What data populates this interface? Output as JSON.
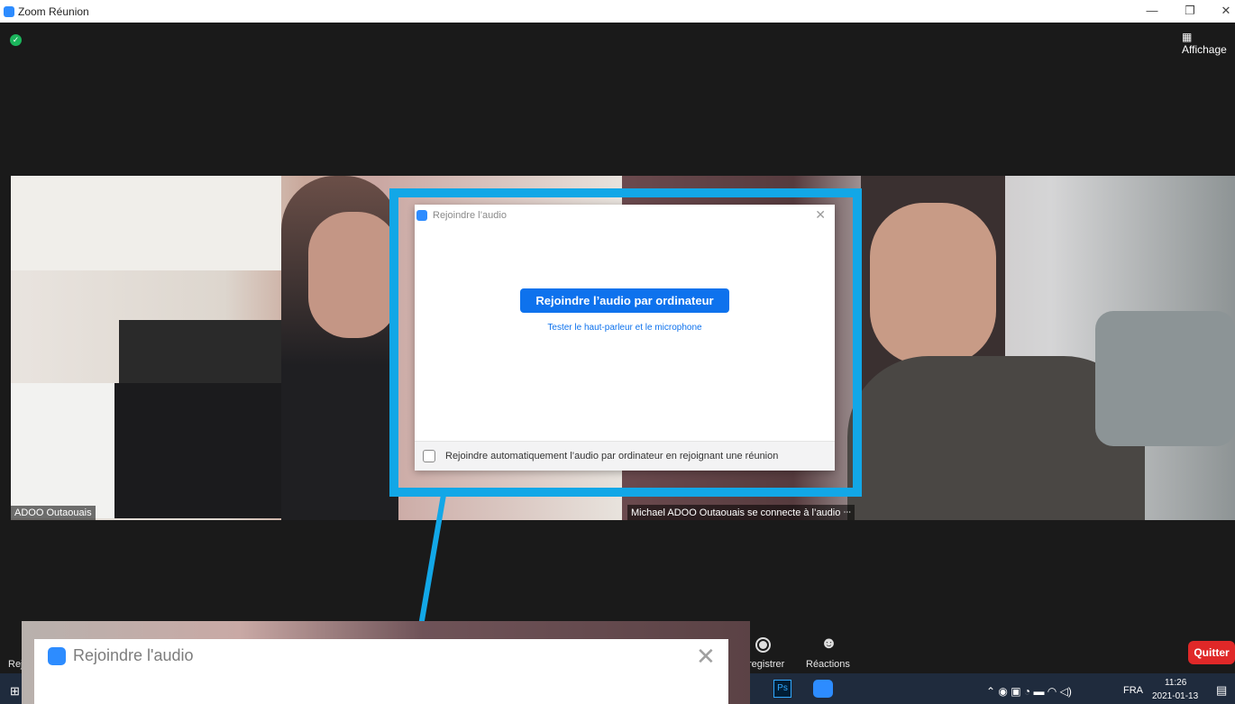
{
  "window": {
    "title": "Zoom Réunion",
    "controls": [
      "—",
      "❐",
      "✕"
    ]
  },
  "meeting": {
    "view_button": "Affichage",
    "participants": [
      {
        "label": "ADOO Outaouais"
      },
      {
        "label": "Michael ADOO Outaouais se connecte à l’audio ᐧᐧᐧ"
      }
    ]
  },
  "dialog": {
    "title": "Rejoindre l’audio",
    "join_button": "Rejoindre l’audio par ordinateur",
    "test_link": "Tester le haut-parleur et le microphone",
    "auto_join_label": "Rejoindre automatiquement l’audio par ordinateur en rejoignant une réunion"
  },
  "zoomed_dialog": {
    "title": "Rejoindre l'audio"
  },
  "toolbar": {
    "left_fragment": "Rej",
    "record_label": "registrer",
    "reactions_label": "Réactions",
    "quit_button": "Quitter"
  },
  "taskbar": {
    "apps": [
      "Ps"
    ],
    "language": "FRA",
    "time": "11:26",
    "date": "2021-01-13"
  },
  "colors": {
    "accent": "#0e72ed",
    "highlight": "#12a7e7",
    "quit": "#e02828"
  }
}
